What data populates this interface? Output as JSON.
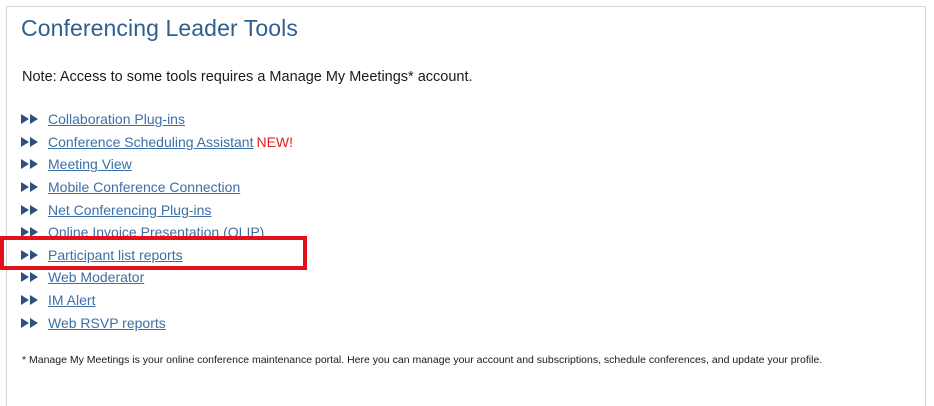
{
  "page": {
    "title": "Conferencing Leader Tools",
    "note": "Note: Access to some tools requires a Manage My Meetings* account."
  },
  "links": [
    {
      "label": "Collaboration Plug-ins"
    },
    {
      "label": "Conference Scheduling Assistant",
      "badge": "NEW!"
    },
    {
      "label": "Meeting View"
    },
    {
      "label": "Mobile Conference Connection"
    },
    {
      "label": "Net Conferencing Plug-ins"
    },
    {
      "label": "Online Invoice Presentation (OLIP)"
    },
    {
      "label": "Participant list reports"
    },
    {
      "label": "Web Moderator"
    },
    {
      "label": "IM Alert"
    },
    {
      "label": "Web RSVP reports"
    }
  ],
  "footnote": "* Manage My Meetings is your online conference maintenance portal. Here you can manage your account and subscriptions, schedule conferences, and update your profile.",
  "icons": {
    "bullet": "double-arrow-right-icon"
  },
  "colors": {
    "title": "#2f5f8f",
    "link": "#3b6fa8",
    "new_badge": "#e02020",
    "highlight": "#e3101b",
    "arrow": "#2e4f7f"
  }
}
